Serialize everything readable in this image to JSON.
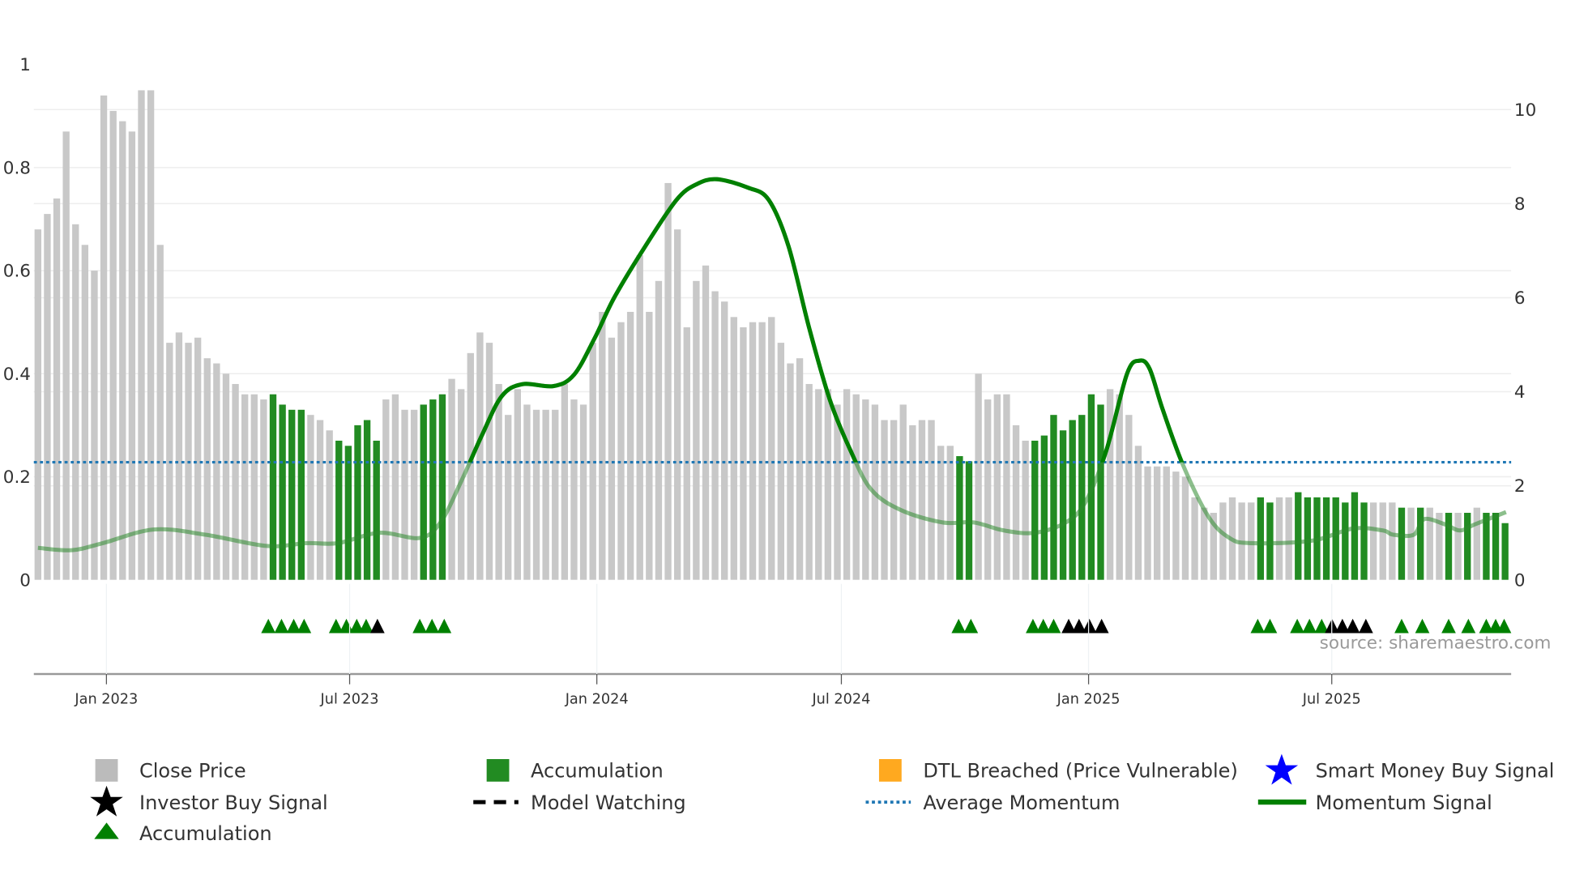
{
  "chart_data": {
    "type": "bar",
    "title": "",
    "x_start": "2022-11-11",
    "x_step": "weekly",
    "x_ticks": [
      {
        "date": "2023-01-01",
        "label": "Jan 2023"
      },
      {
        "date": "2023-07-01",
        "label": "Jul 2023"
      },
      {
        "date": "2024-01-01",
        "label": "Jan 2024"
      },
      {
        "date": "2024-07-01",
        "label": "Jul 2024"
      },
      {
        "date": "2025-01-01",
        "label": "Jan 2025"
      },
      {
        "date": "2025-07-01",
        "label": "Jul 2025"
      }
    ],
    "y_left": {
      "range": [
        0,
        1
      ],
      "ticks": [
        "0",
        "0.2",
        "0.4",
        "0.6",
        "0.8",
        "1"
      ]
    },
    "y_right": {
      "range": [
        0,
        10
      ],
      "ticks": [
        "0",
        "2",
        "4",
        "6",
        "8",
        "10"
      ]
    },
    "close_price": [
      0.68,
      0.71,
      0.74,
      0.87,
      0.69,
      0.65,
      0.6,
      0.94,
      0.91,
      0.89,
      0.87,
      0.95,
      0.95,
      0.65,
      0.46,
      0.48,
      0.46,
      0.47,
      0.43,
      0.42,
      0.4,
      0.38,
      0.36,
      0.36,
      0.35,
      0.36,
      0.34,
      0.33,
      0.33,
      0.32,
      0.31,
      0.29,
      0.27,
      0.26,
      0.3,
      0.31,
      0.27,
      0.35,
      0.36,
      0.33,
      0.33,
      0.34,
      0.35,
      0.36,
      0.39,
      0.37,
      0.44,
      0.48,
      0.46,
      0.38,
      0.32,
      0.37,
      0.34,
      0.33,
      0.33,
      0.33,
      0.38,
      0.35,
      0.34,
      0.46,
      0.52,
      0.47,
      0.5,
      0.52,
      0.63,
      0.52,
      0.58,
      0.77,
      0.68,
      0.49,
      0.58,
      0.61,
      0.56,
      0.54,
      0.51,
      0.49,
      0.5,
      0.5,
      0.51,
      0.46,
      0.42,
      0.43,
      0.38,
      0.37,
      0.37,
      0.34,
      0.37,
      0.36,
      0.35,
      0.34,
      0.31,
      0.31,
      0.34,
      0.3,
      0.31,
      0.31,
      0.26,
      0.26,
      0.24,
      0.23,
      0.4,
      0.35,
      0.36,
      0.36,
      0.3,
      0.27,
      0.27,
      0.28,
      0.32,
      0.29,
      0.31,
      0.32,
      0.36,
      0.34,
      0.37,
      0.36,
      0.32,
      0.26,
      0.22,
      0.22,
      0.22,
      0.21,
      0.2,
      0.16,
      0.14,
      0.13,
      0.15,
      0.16,
      0.15,
      0.15,
      0.16,
      0.15,
      0.16,
      0.16,
      0.17,
      0.16,
      0.16,
      0.16,
      0.16,
      0.15,
      0.17,
      0.15,
      0.15,
      0.15,
      0.15,
      0.14,
      0.14,
      0.14,
      0.14,
      0.13,
      0.13,
      0.13,
      0.13,
      0.14,
      0.13,
      0.13,
      0.11
    ],
    "accumulation_weeks": [
      25,
      26,
      27,
      28,
      32,
      33,
      34,
      35,
      36,
      41,
      42,
      43,
      98,
      99,
      106,
      107,
      108,
      109,
      110,
      111,
      112,
      113,
      130,
      131,
      134,
      135,
      136,
      137,
      138,
      139,
      140,
      141,
      145,
      147,
      150,
      152,
      154,
      155,
      156
    ],
    "average_momentum": 2.5,
    "momentum_signal": [
      [
        0,
        0.68
      ],
      [
        3.6,
        0.63
      ],
      [
        6.9,
        0.78
      ],
      [
        12.3,
        1.07
      ],
      [
        17.8,
        0.96
      ],
      [
        24.3,
        0.72
      ],
      [
        28.6,
        0.78
      ],
      [
        31.9,
        0.78
      ],
      [
        36.3,
        1.0
      ],
      [
        40.6,
        0.89
      ],
      [
        42.8,
        1.22
      ],
      [
        45,
        2.09
      ],
      [
        47.2,
        3.07
      ],
      [
        49.3,
        3.9
      ],
      [
        51.5,
        4.16
      ],
      [
        54.8,
        4.12
      ],
      [
        57,
        4.36
      ],
      [
        59.2,
        5.14
      ],
      [
        61.3,
        6.01
      ],
      [
        64.6,
        7.1
      ],
      [
        67.9,
        8.08
      ],
      [
        70,
        8.41
      ],
      [
        72.2,
        8.52
      ],
      [
        75.5,
        8.34
      ],
      [
        77.7,
        8.08
      ],
      [
        79.8,
        7.1
      ],
      [
        82,
        5.36
      ],
      [
        84.2,
        3.83
      ],
      [
        86.4,
        2.75
      ],
      [
        88.6,
        1.92
      ],
      [
        91.8,
        1.48
      ],
      [
        96.2,
        1.22
      ],
      [
        99.5,
        1.22
      ],
      [
        102.7,
        1.05
      ],
      [
        106,
        1.0
      ],
      [
        109.3,
        1.22
      ],
      [
        111.4,
        1.66
      ],
      [
        113.6,
        2.75
      ],
      [
        115.8,
        4.38
      ],
      [
        117.1,
        4.66
      ],
      [
        118.2,
        4.49
      ],
      [
        119.6,
        3.62
      ],
      [
        121.8,
        2.42
      ],
      [
        124.5,
        1.33
      ],
      [
        126.7,
        0.89
      ],
      [
        128.9,
        0.78
      ],
      [
        135.4,
        0.83
      ],
      [
        139.8,
        1.09
      ],
      [
        143,
        1.05
      ],
      [
        144.1,
        0.96
      ],
      [
        146.3,
        0.96
      ],
      [
        147.4,
        1.29
      ],
      [
        149.6,
        1.18
      ],
      [
        151.2,
        1.05
      ],
      [
        152.8,
        1.18
      ],
      [
        156.1,
        1.44
      ]
    ],
    "markers": [
      {
        "week": 24.5,
        "type": "accumulation"
      },
      {
        "week": 25.9,
        "type": "accumulation"
      },
      {
        "week": 27.2,
        "type": "accumulation"
      },
      {
        "week": 28.3,
        "type": "accumulation"
      },
      {
        "week": 31.7,
        "type": "accumulation"
      },
      {
        "week": 32.8,
        "type": "accumulation"
      },
      {
        "week": 33.9,
        "type": "accumulation"
      },
      {
        "week": 34.9,
        "type": "accumulation"
      },
      {
        "week": 36.1,
        "type": "investor"
      },
      {
        "week": 40.6,
        "type": "accumulation"
      },
      {
        "week": 41.9,
        "type": "accumulation"
      },
      {
        "week": 43.2,
        "type": "accumulation"
      },
      {
        "week": 97.9,
        "type": "accumulation"
      },
      {
        "week": 99.2,
        "type": "accumulation"
      },
      {
        "week": 105.8,
        "type": "accumulation"
      },
      {
        "week": 106.9,
        "type": "accumulation"
      },
      {
        "week": 108,
        "type": "accumulation"
      },
      {
        "week": 109.6,
        "type": "investor"
      },
      {
        "week": 110.7,
        "type": "investor"
      },
      {
        "week": 111.8,
        "type": "investor"
      },
      {
        "week": 113.1,
        "type": "investor"
      },
      {
        "week": 129.7,
        "type": "accumulation"
      },
      {
        "week": 131,
        "type": "accumulation"
      },
      {
        "week": 133.9,
        "type": "accumulation"
      },
      {
        "week": 135.2,
        "type": "accumulation"
      },
      {
        "week": 136.5,
        "type": "accumulation"
      },
      {
        "week": 137.6,
        "type": "investor"
      },
      {
        "week": 138.7,
        "type": "investor"
      },
      {
        "week": 139.8,
        "type": "investor"
      },
      {
        "week": 141.2,
        "type": "investor"
      },
      {
        "week": 145,
        "type": "accumulation"
      },
      {
        "week": 147.2,
        "type": "accumulation"
      },
      {
        "week": 150,
        "type": "accumulation"
      },
      {
        "week": 152.1,
        "type": "accumulation"
      },
      {
        "week": 154,
        "type": "accumulation"
      },
      {
        "week": 155,
        "type": "accumulation"
      },
      {
        "week": 155.9,
        "type": "accumulation"
      }
    ],
    "source": "source: sharemaestro.com",
    "legend": {
      "placement": "bottom",
      "close_price": "Close Price",
      "accumulation_bar": "Accumulation",
      "dtl_breached": "DTL Breached (Price Vulnerable)",
      "smart_money": "Smart Money Buy Signal",
      "investor_buy": "Investor Buy Signal",
      "model_watching": "Model Watching",
      "average_momentum": "Average Momentum",
      "momentum_signal": "Momentum Signal",
      "accumulation_marker": "Accumulation"
    },
    "colors": {
      "close": "#c8c8c8",
      "accumulation": "#228b22",
      "dtl": "#ffa91f",
      "smart_money": "#0000ff",
      "investor": "#000000",
      "avg_momentum": "#1f77b4",
      "momentum": "#008000"
    }
  }
}
